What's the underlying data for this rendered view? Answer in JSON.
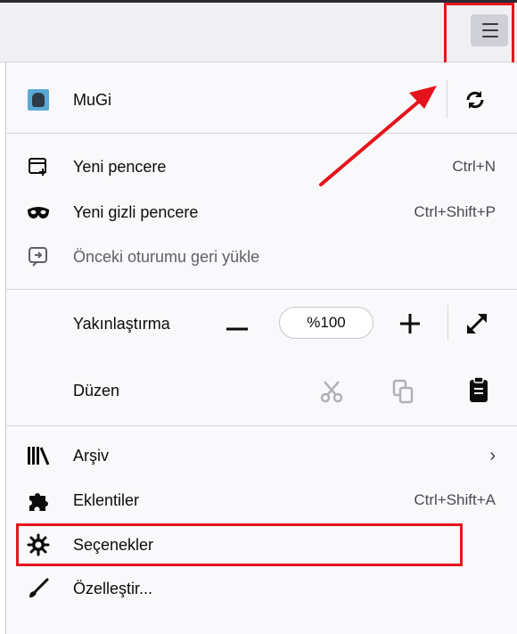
{
  "toolbar": {
    "menu_icon": "hamburger-menu-icon"
  },
  "account": {
    "name": "MuGi",
    "avatar_icon": "user-avatar-icon",
    "sync_icon": "sync-icon"
  },
  "window_items": [
    {
      "label": "Yeni pencere",
      "shortcut": "Ctrl+N",
      "icon": "new-window-icon"
    },
    {
      "label": "Yeni gizli pencere",
      "shortcut": "Ctrl+Shift+P",
      "icon": "private-mask-icon"
    },
    {
      "label": "Önceki oturumu geri yükle",
      "shortcut": "",
      "icon": "restore-session-icon"
    }
  ],
  "zoom": {
    "label": "Yakınlaştırma",
    "value": "%100",
    "minus_icon": "zoom-out-icon",
    "plus_icon": "zoom-in-icon",
    "fullscreen_icon": "fullscreen-icon"
  },
  "edit": {
    "label": "Düzen",
    "cut_icon": "cut-icon",
    "copy_icon": "copy-icon",
    "paste_icon": "paste-icon"
  },
  "bottom_items": [
    {
      "label": "Arşiv",
      "shortcut": "",
      "icon": "library-icon",
      "has_submenu": true
    },
    {
      "label": "Eklentiler",
      "shortcut": "Ctrl+Shift+A",
      "icon": "puzzle-icon"
    },
    {
      "label": "Seçenekler",
      "shortcut": "",
      "icon": "gear-icon"
    },
    {
      "label": "Özelleştir...",
      "shortcut": "",
      "icon": "brush-icon"
    }
  ],
  "colors": {
    "highlight": "#e5141c",
    "panel": "#f9f9fb",
    "toolbar": "#f0f0f4"
  }
}
